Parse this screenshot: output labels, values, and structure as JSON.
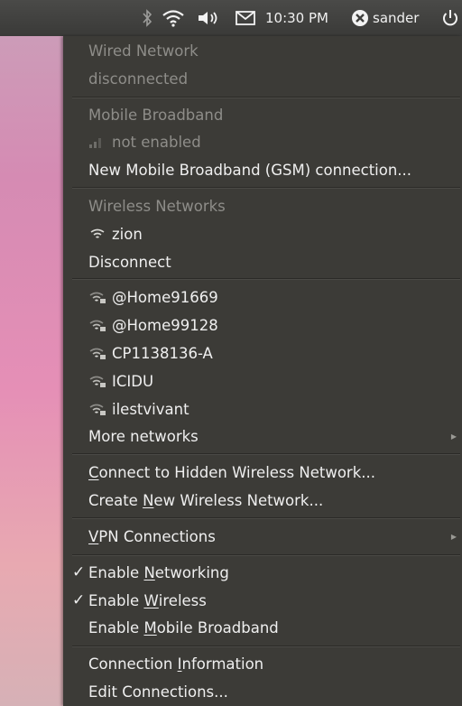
{
  "panel": {
    "clock": "10:30 PM",
    "user": "sander"
  },
  "menu": {
    "wired_header": "Wired Network",
    "wired_status": "disconnected",
    "mobile_header": "Mobile Broadband",
    "mobile_status": "not enabled",
    "new_mobile": "New Mobile Broadband (GSM) connection...",
    "wireless_header": "Wireless Networks",
    "connected_network": "zion",
    "disconnect": "Disconnect",
    "networks": [
      "@Home91669",
      "@Home99128",
      "CP1138136-A",
      "ICIDU",
      "ilestvivant"
    ],
    "more_networks": "More networks",
    "connect_hidden": {
      "pre": "",
      "u": "C",
      "post": "onnect to Hidden Wireless Network..."
    },
    "create_new": {
      "pre": "Create ",
      "u": "N",
      "post": "ew Wireless Network..."
    },
    "vpn": {
      "pre": "",
      "u": "V",
      "post": "PN Connections"
    },
    "enable_networking": {
      "pre": "Enable ",
      "u": "N",
      "post": "etworking"
    },
    "enable_wireless": {
      "pre": "Enable ",
      "u": "W",
      "post": "ireless"
    },
    "enable_mobile": {
      "pre": "Enable ",
      "u": "M",
      "post": "obile Broadband"
    },
    "connection_info": {
      "pre": "Connection ",
      "u": "I",
      "post": "nformation"
    },
    "edit_connections": "Edit Connections...",
    "check_mark": "✓"
  },
  "colors": {
    "menu_bg": "#3c3b37",
    "panel_bg": "#3f3f3d",
    "disabled_text": "#8e8d89"
  },
  "icons": [
    "bluetooth-icon",
    "wifi-icon",
    "volume-icon",
    "mail-icon",
    "user-status-icon",
    "power-icon"
  ]
}
